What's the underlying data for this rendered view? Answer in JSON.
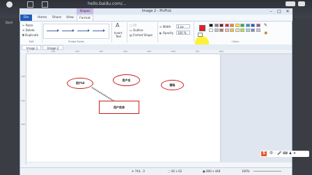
{
  "browser": {
    "url": "hello.baidu.com/...",
    "left_tab": "Dash"
  },
  "window": {
    "title": "Image 2 - PicPick",
    "context_tab": "Shapes",
    "controls": [
      "–",
      "□",
      "✕"
    ]
  },
  "menu": {
    "tabs": [
      "File",
      "Home",
      "Share",
      "View",
      "Format"
    ]
  },
  "ribbon": {
    "edit": {
      "items": [
        "Paste",
        "Delete",
        "Duplicate"
      ],
      "label": "Edit"
    },
    "shape_styles_label": "Shape Styles",
    "insert_text": [
      "Insert",
      "Text"
    ],
    "format": {
      "items": [
        "Fill",
        "Outline",
        "Format Shape"
      ]
    },
    "width": {
      "label": "Width",
      "value": "2 px"
    },
    "opacity": {
      "label": "Opacity",
      "value": "100 %"
    },
    "colors_label": "Colors"
  },
  "colors": {
    "primary": "#ed1c24",
    "secondary": "#ffffff",
    "palette_row1": [
      "#000000",
      "#7f7f7f",
      "#880015",
      "#ed1c24",
      "#ff7f27",
      "#fff200",
      "#22b14c",
      "#00a2e8",
      "#3f48cc",
      "#a349a4"
    ],
    "palette_row2": [
      "#ffffff",
      "#c3c3c3",
      "#b97a57",
      "#ffaec9",
      "#ffc90e",
      "#efe4b0",
      "#b5e61d",
      "#99d9ea",
      "#7092be",
      "#c8bfe7"
    ]
  },
  "doc_tabs": [
    "Image 1",
    "Image 2"
  ],
  "ruler_top": [
    "0",
    "100",
    "200",
    "300",
    "400",
    "500",
    "600",
    "700",
    "800"
  ],
  "ruler_left": [
    "100",
    "200",
    "300"
  ],
  "canvas": {
    "shapes": [
      {
        "name": "ellipse-shape-1",
        "label": "用户id"
      },
      {
        "name": "ellipse-shape-2",
        "label": "用户名"
      },
      {
        "name": "ellipse-shape-3",
        "label": "密码"
      },
      {
        "name": "rect-shape-1",
        "label": "用户实体"
      }
    ]
  },
  "status": {
    "pos": "744, -3",
    "sel": "82 x 62",
    "size": "800 x 448",
    "zoom": "100%"
  }
}
